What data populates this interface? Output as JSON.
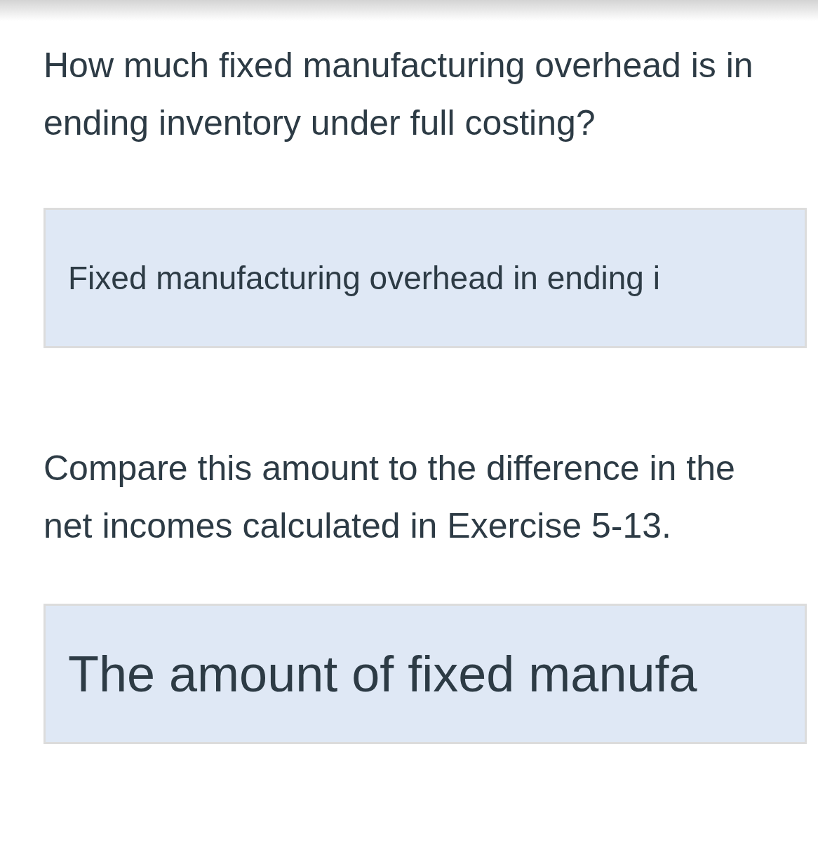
{
  "blocks": [
    {
      "kind": "question",
      "text": "How much fixed manufacturing overhead is in ending inventory under full costing?"
    },
    {
      "kind": "answer",
      "text": "Fixed manufacturing overhead in ending i"
    },
    {
      "kind": "question",
      "text": "Compare this amount to the difference in the net incomes calculated in Exercise 5-13."
    },
    {
      "kind": "callout",
      "text": "The amount of fixed manufa"
    }
  ]
}
